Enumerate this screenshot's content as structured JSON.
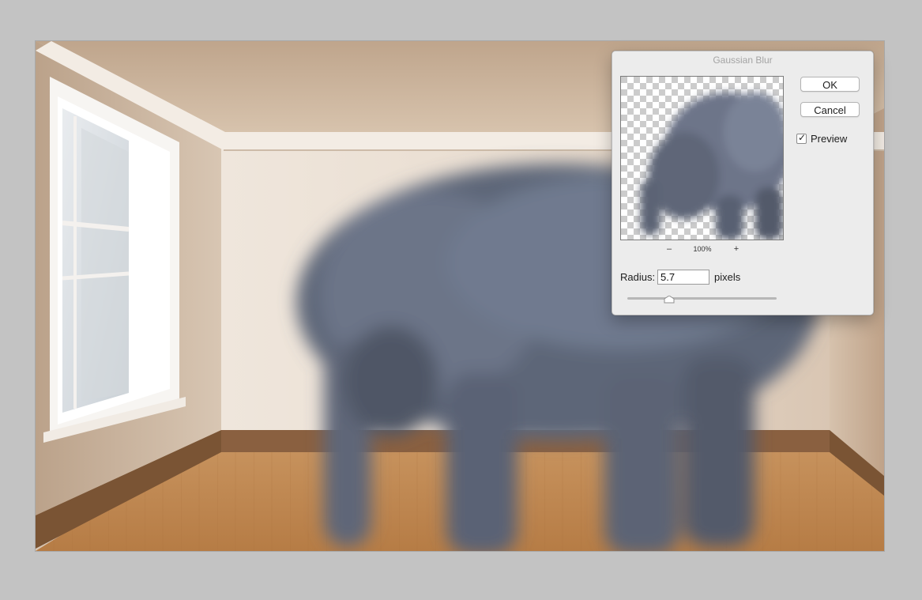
{
  "dialog": {
    "title": "Gaussian Blur",
    "ok_label": "OK",
    "cancel_label": "Cancel",
    "preview_label": "Preview",
    "preview_checked": true,
    "zoom": {
      "minus": "–",
      "value": "100%",
      "plus": "+"
    },
    "radius": {
      "label": "Radius:",
      "value": "5.7",
      "unit": "pixels",
      "slider_fraction": 0.28
    }
  },
  "colors": {
    "app_background": "#c3c3c3",
    "dialog_background": "#ececec",
    "title_text": "#a4a4a4"
  }
}
